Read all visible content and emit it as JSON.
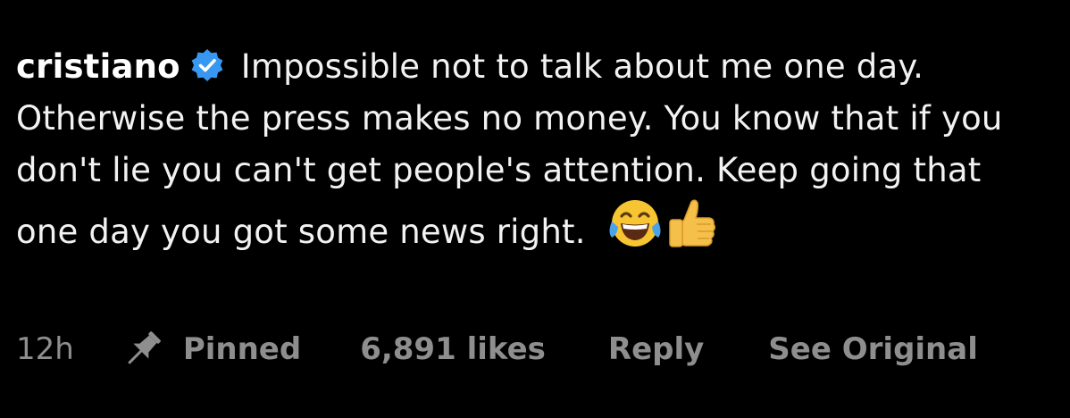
{
  "comment": {
    "username": "cristiano",
    "verified_badge": "verified-badge-icon",
    "text": "Impossible not to talk about me one day. Otherwise the press makes no money. You know that if you don't lie you can't get people's attention. Keep going that one day you got some news right.",
    "emojis": [
      "face-with-tears-of-joy-emoji",
      "thumbs-up-emoji"
    ]
  },
  "footer": {
    "time": "12h",
    "pin_icon": "pin-icon",
    "pinned_label": "Pinned",
    "likes": "6,891 likes",
    "reply_label": "Reply",
    "see_original_label": "See Original"
  },
  "colors": {
    "background": "#000000",
    "text": "#f2f2f2",
    "muted": "#8e8e8e",
    "verified_blue": "#3897f0"
  }
}
